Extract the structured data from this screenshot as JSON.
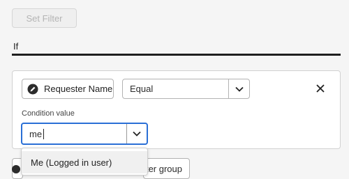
{
  "toolbar": {
    "set_filter_label": "Set Filter"
  },
  "section": {
    "if_label": "If"
  },
  "condition": {
    "field_label": "Requester Name",
    "operator_value": "Equal",
    "value_label": "Condition value",
    "value_text": "me"
  },
  "dropdown": {
    "options": [
      "Me (Logged in user)"
    ]
  },
  "footer": {
    "add_group_label_partial": "ter group"
  },
  "icons": {
    "field": "pencil-circle-icon",
    "operator_chevron": "chevron-down-icon",
    "remove": "close-icon",
    "value_chevron": "chevron-down-icon"
  },
  "colors": {
    "focus_border": "#2a6fd6"
  }
}
